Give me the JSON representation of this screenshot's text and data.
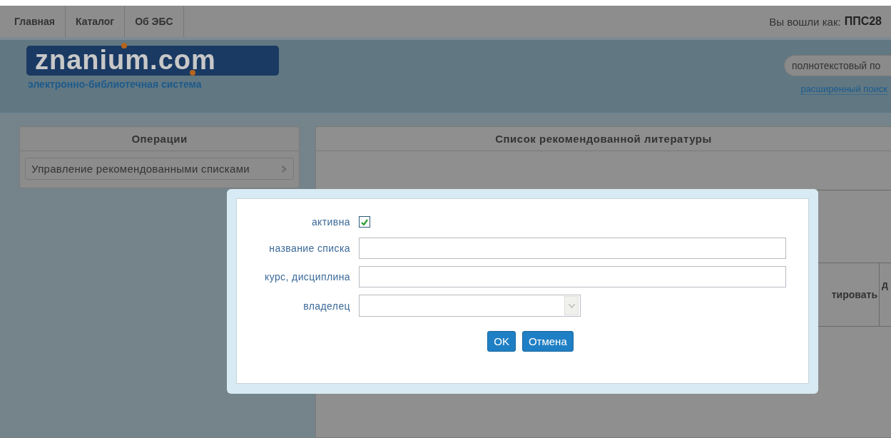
{
  "nav": {
    "items": [
      {
        "label": "Главная"
      },
      {
        "label": "Каталог"
      },
      {
        "label": "Об ЭБС"
      }
    ],
    "user_prefix": "Вы вошли как:",
    "user": "ППС28"
  },
  "header": {
    "logo": "znanium.com",
    "tagline": "электронно-библиотечная система",
    "search": {
      "placeholder": "полнотекстовый по"
    },
    "advanced_search": "расширенный поиск"
  },
  "operations": {
    "title": "Операции",
    "items": [
      {
        "label": "Управление рекомендованными списками"
      }
    ]
  },
  "list_panel": {
    "title": "Список рекомендованной литературы",
    "table": {
      "columns": [
        "тировать",
        "д"
      ]
    }
  },
  "dialog": {
    "fields": [
      {
        "kind": "checkbox",
        "label": "активна",
        "checked": true
      },
      {
        "kind": "text",
        "label": "название списка"
      },
      {
        "kind": "text",
        "label": "курс, дисциплина"
      },
      {
        "kind": "select",
        "label": "владелец"
      }
    ],
    "buttons": [
      "OK",
      "Отмена"
    ]
  }
}
